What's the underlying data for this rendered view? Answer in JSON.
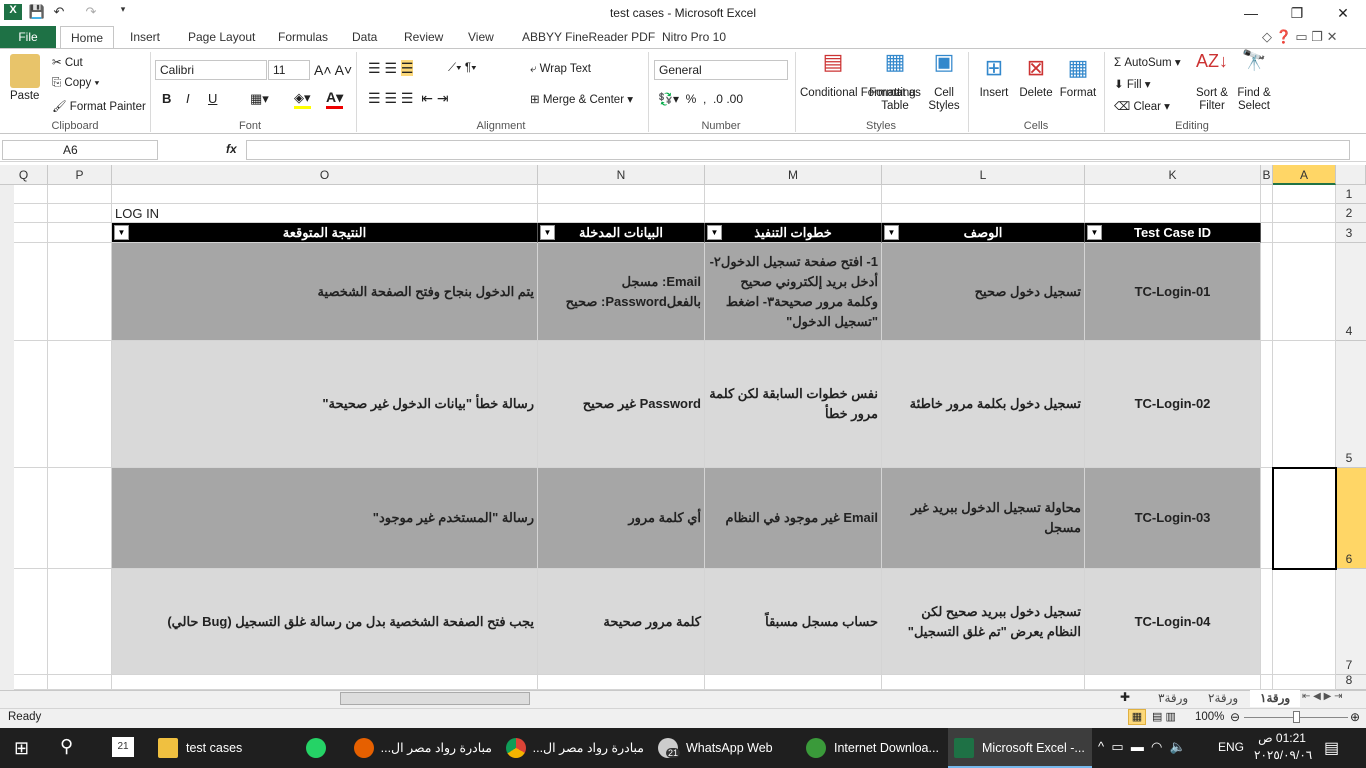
{
  "window": {
    "title": "test cases  -  Microsoft Excel"
  },
  "tabs": [
    "File",
    "Home",
    "Insert",
    "Page Layout",
    "Formulas",
    "Data",
    "Review",
    "View",
    "ABBYY FineReader PDF",
    "Nitro Pro 10"
  ],
  "ribbon": {
    "clipboard": {
      "label": "Clipboard",
      "paste": "Paste",
      "cut": "Cut",
      "copy": "Copy",
      "format_painter": "Format Painter"
    },
    "font": {
      "label": "Font",
      "name": "Calibri",
      "size": "11",
      "bold": "B",
      "italic": "I",
      "underline": "U"
    },
    "alignment": {
      "label": "Alignment",
      "wrap": "Wrap Text",
      "merge": "Merge & Center"
    },
    "number": {
      "label": "Number",
      "format": "General"
    },
    "styles": {
      "label": "Styles",
      "conditional": "Conditional Formatting",
      "format_table": "Format as Table",
      "cell_styles": "Cell Styles"
    },
    "cells": {
      "label": "Cells",
      "insert": "Insert",
      "delete": "Delete",
      "format": "Format"
    },
    "editing": {
      "label": "Editing",
      "autosum": "AutoSum",
      "fill": "Fill",
      "clear": "Clear",
      "sort": "Sort & Filter",
      "find": "Find & Select"
    }
  },
  "formula_bar": {
    "name_box": "A6",
    "fx": "fx",
    "value": ""
  },
  "columns": [
    {
      "name": "A"
    },
    {
      "name": "B"
    },
    {
      "name": "K"
    },
    {
      "name": "L"
    },
    {
      "name": "M"
    },
    {
      "name": "N"
    },
    {
      "name": "O"
    },
    {
      "name": "P"
    },
    {
      "name": "Q"
    }
  ],
  "rows": [
    "1",
    "2",
    "3",
    "4",
    "5",
    "6",
    "7",
    "8"
  ],
  "sheet": {
    "title_cell": "LOG IN",
    "headers": [
      "Test Case ID",
      "الوصف",
      "خطوات التنفيذ",
      "البيانات المدخلة",
      "النتيجة المتوقعة"
    ],
    "records": [
      [
        "TC-Login-01",
        "تسجيل دخول صحيح",
        "1- افتح صفحة تسجيل الدخول٢- أدخل بريد إلكتروني صحيح وكلمة مرور صحيحة٣- اضغط \"تسجيل الدخول\"",
        "Email: مسجل بالفعلPassword: صحيح",
        "يتم الدخول بنجاح وفتح الصفحة الشخصية"
      ],
      [
        "TC-Login-02",
        "تسجيل دخول بكلمة مرور خاطئة",
        "نفس خطوات السابقة لكن كلمة مرور خطأ",
        "Password غير صحيح",
        "رسالة خطأ \"بيانات الدخول غير صحيحة\""
      ],
      [
        "TC-Login-03",
        "محاولة تسجيل الدخول ببريد غير مسجل",
        "Email غير موجود في النظام",
        "أي كلمة مرور",
        "رسالة \"المستخدم غير موجود\""
      ],
      [
        "TC-Login-04",
        "تسجيل دخول ببريد صحيح لكن النظام يعرض \"تم غلق التسجيل\"",
        "حساب مسجل مسبقاً",
        "كلمة مرور صحيحة",
        "يجب فتح الصفحة الشخصية بدل من رسالة غلق التسجيل (Bug حالي)"
      ]
    ]
  },
  "sheet_tabs": [
    "ورقة١",
    "ورقة٢",
    "ورقة٣"
  ],
  "status": {
    "ready": "Ready",
    "zoom": "100%",
    "zoom_level": 100
  },
  "taskbar": {
    "items": [
      "test cases",
      "",
      "مبادرة رواد مصر ال...",
      "مبادرة رواد مصر ال...",
      "WhatsApp Web",
      "Internet Downloa...",
      "Microsoft Excel -..."
    ],
    "lang": "ENG",
    "time": "01:21 ص",
    "date": "٢٠٢٥/٠٩/٠٦",
    "badge": "21",
    "calendar": "21"
  },
  "colors": {
    "excel_green": "#1e7145",
    "row_dark": "#a6a6a6",
    "row_light": "#d9d9d9",
    "selected": "#ffd666"
  }
}
